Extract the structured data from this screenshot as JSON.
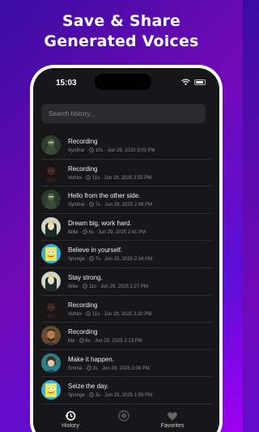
{
  "promo": {
    "line1": "Save & Share",
    "line2": "Generated Voices"
  },
  "status_bar": {
    "time": "15:03"
  },
  "search": {
    "placeholder": "Search history..."
  },
  "history": [
    {
      "title": "Recording",
      "voice": "Synthar",
      "duration": "10s",
      "date": "Jun 29, 2025 3:03 PM",
      "avatar": "robot-avatar"
    },
    {
      "title": "Recording",
      "voice": "Vortex",
      "duration": "11s",
      "date": "Jun 29, 2025 2:55 PM",
      "avatar": "dark-figure-avatar"
    },
    {
      "title": "Hello from the other side.",
      "voice": "Synthar",
      "duration": "7s",
      "date": "Jun 29, 2025 2:48 PM",
      "avatar": "robot-avatar"
    },
    {
      "title": "Dream big, work hard.",
      "voice": "Billie",
      "duration": "6s",
      "date": "Jun 29, 2025 2:41 PM",
      "avatar": "blonde-avatar"
    },
    {
      "title": "Believe in yourself.",
      "voice": "Sponge",
      "duration": "7s",
      "date": "Jun 29, 2025 2:34 PM",
      "avatar": "sponge-avatar"
    },
    {
      "title": "Stay strong.",
      "voice": "Billie",
      "duration": "11s",
      "date": "Jun 29, 2025 2:27 PM",
      "avatar": "blonde-avatar"
    },
    {
      "title": "Recording",
      "voice": "Vortex",
      "duration": "11s",
      "date": "Jun 29, 2025 2:20 PM",
      "avatar": "dark-figure-avatar"
    },
    {
      "title": "Recording",
      "voice": "Mo",
      "duration": "6s",
      "date": "Jun 29, 2025 2:13 PM",
      "avatar": "man-avatar"
    },
    {
      "title": "Make it happen.",
      "voice": "Emma",
      "duration": "3s",
      "date": "Jun 29, 2025 2:06 PM",
      "avatar": "woman-avatar"
    },
    {
      "title": "Seize the day.",
      "voice": "Sponge",
      "duration": "3s",
      "date": "Jun 29, 2025 1:59 PM",
      "avatar": "sponge-avatar"
    },
    {
      "title": "",
      "voice": "",
      "duration": "",
      "date": "",
      "avatar": "purple-avatar"
    }
  ],
  "tabs": [
    {
      "label": "History",
      "icon": "history-icon"
    },
    {
      "label": "",
      "icon": "voice-wave-icon"
    },
    {
      "label": "Favorites",
      "icon": "heart-icon"
    }
  ],
  "colors": {
    "background": "#17171a",
    "row_divider": "#2c2c31",
    "accent_gradient": [
      "#3a0ca3",
      "#a100f2"
    ]
  }
}
